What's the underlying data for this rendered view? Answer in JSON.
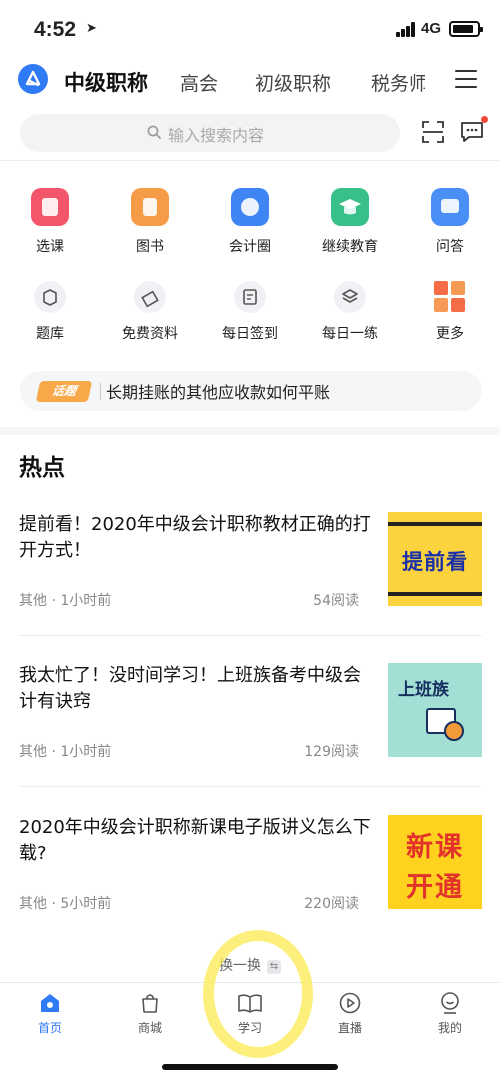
{
  "status_bar": {
    "time": "4:52",
    "network": "4G"
  },
  "header": {
    "active_category": "中级职称",
    "categories": [
      "高会",
      "初级职称",
      "税务师"
    ]
  },
  "search": {
    "placeholder": "输入搜索内容"
  },
  "grid_row1": [
    {
      "label": "选课",
      "color": "#f3566a"
    },
    {
      "label": "图书",
      "color": "#f69b46"
    },
    {
      "label": "会计圈",
      "color": "#3f86f4"
    },
    {
      "label": "继续教育",
      "color": "#39c08a"
    },
    {
      "label": "问答",
      "color": "#4a8ff6"
    }
  ],
  "grid_row2": [
    {
      "label": "题库"
    },
    {
      "label": "免费资料"
    },
    {
      "label": "每日签到"
    },
    {
      "label": "每日一练"
    },
    {
      "label": "更多"
    }
  ],
  "topic": {
    "tag": "话题",
    "text": "长期挂账的其他应收款如何平账"
  },
  "hot": {
    "title": "热点",
    "articles": [
      {
        "title": "提前看！2020年中级会计职称教材正确的打开方式！",
        "meta": "其他 · 1小时前",
        "reads": "54阅读",
        "thumb_text": "提前看"
      },
      {
        "title": "我太忙了！没时间学习！上班族备考中级会计有诀窍",
        "meta": "其他 · 1小时前",
        "reads": "129阅读",
        "thumb_text": "上班族"
      },
      {
        "title": "2020年中级会计职称新课电子版讲义怎么下载?",
        "meta": "其他 · 5小时前",
        "reads": "220阅读",
        "thumb_text_line1": "新课",
        "thumb_text_line2": "开通"
      }
    ]
  },
  "refresh_label": "换一换",
  "tabs": [
    "首页",
    "商城",
    "学习",
    "直播",
    "我的"
  ],
  "colors": {
    "accent": "#2f7bf6",
    "highlight": "#fdea56"
  }
}
